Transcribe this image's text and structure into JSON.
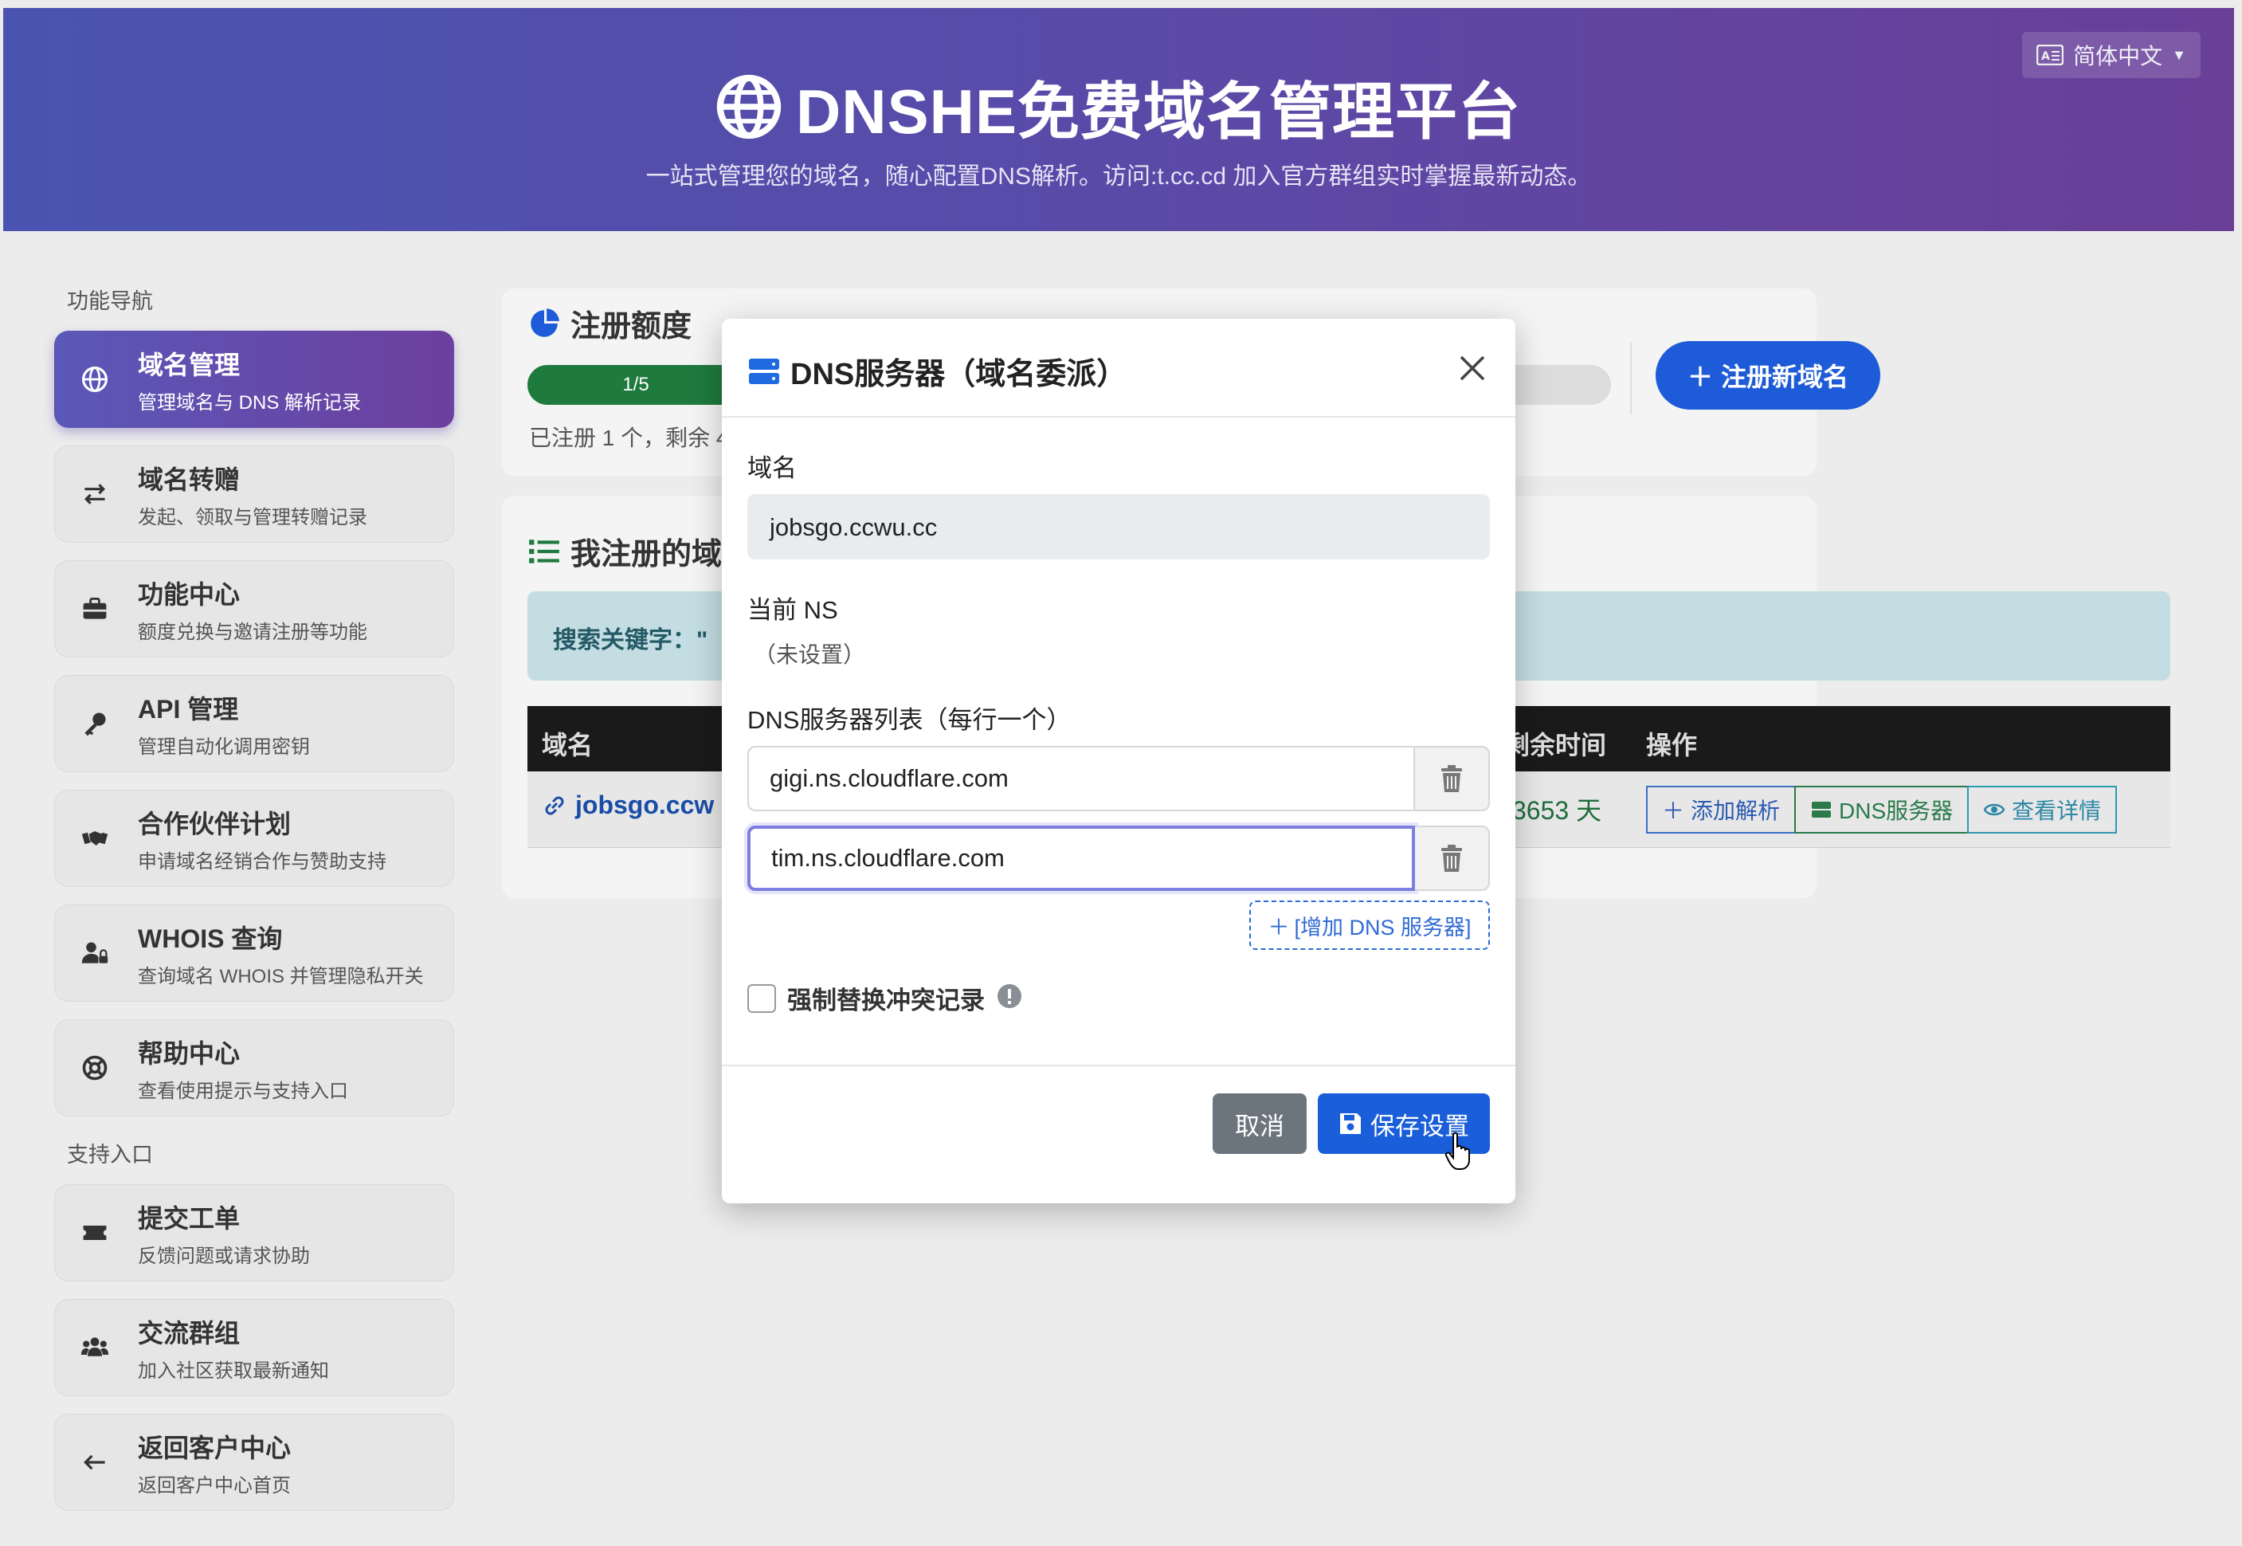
{
  "header": {
    "title": "DNSHE免费域名管理平台",
    "subtitle": "一站式管理您的域名，随心配置DNS解析。访问:t.cc.cd 加入官方群组实时掌握最新动态。",
    "language": "简体中文"
  },
  "sidebar": {
    "section_nav": "功能导航",
    "section_support": "支持入口",
    "items": [
      {
        "title": "域名管理",
        "desc": "管理域名与 DNS 解析记录",
        "icon": "globe-icon"
      },
      {
        "title": "域名转赠",
        "desc": "发起、领取与管理转赠记录",
        "icon": "exchange-icon"
      },
      {
        "title": "功能中心",
        "desc": "额度兑换与邀请注册等功能",
        "icon": "toolbox-icon"
      },
      {
        "title": "API 管理",
        "desc": "管理自动化调用密钥",
        "icon": "key-icon"
      },
      {
        "title": "合作伙伴计划",
        "desc": "申请域名经销合作与赞助支持",
        "icon": "handshake-icon"
      },
      {
        "title": "WHOIS 查询",
        "desc": "查询域名 WHOIS 并管理隐私开关",
        "icon": "user-lock-icon"
      },
      {
        "title": "帮助中心",
        "desc": "查看使用提示与支持入口",
        "icon": "lifebuoy-icon"
      }
    ],
    "support_items": [
      {
        "title": "提交工单",
        "desc": "反馈问题或请求协助",
        "icon": "ticket-icon"
      },
      {
        "title": "交流群组",
        "desc": "加入社区获取最新通知",
        "icon": "users-icon"
      },
      {
        "title": "返回客户中心",
        "desc": "返回客户中心首页",
        "icon": "arrow-left-icon"
      }
    ]
  },
  "quota": {
    "title": "注册额度",
    "progress_label": "1/5",
    "progress_fraction": 0.2,
    "text": "已注册 1 个，剩余 4",
    "register_button": "注册新域名"
  },
  "domains": {
    "title": "我注册的域",
    "search_text": "搜索关键字：\"",
    "columns": {
      "domain": "域名",
      "remaining": "剩余时间",
      "actions": "操作"
    },
    "row": {
      "domain": "jobsgo.ccw",
      "days": "3653 天",
      "add_record": "添加解析",
      "dns_servers": "DNS服务器",
      "view_details": "查看详情"
    }
  },
  "modal": {
    "title": "DNS服务器（域名委派）",
    "domain_label": "域名",
    "domain_value": "jobsgo.ccwu.cc",
    "current_ns_label": "当前 NS",
    "current_ns_value": "（未设置）",
    "ns_list_label": "DNS服务器列表（每行一个）",
    "ns_servers": [
      "gigi.ns.cloudflare.com",
      "tim.ns.cloudflare.com"
    ],
    "add_ns_button": "[增加 DNS 服务器]",
    "force_replace_label": "强制替换冲突记录",
    "cancel_button": "取消",
    "save_button": "保存设置"
  },
  "colors": {
    "header_start": "#4a54b0",
    "header_end": "#6a3f98",
    "primary": "#1a5fd9",
    "success": "#1f7a3e"
  }
}
